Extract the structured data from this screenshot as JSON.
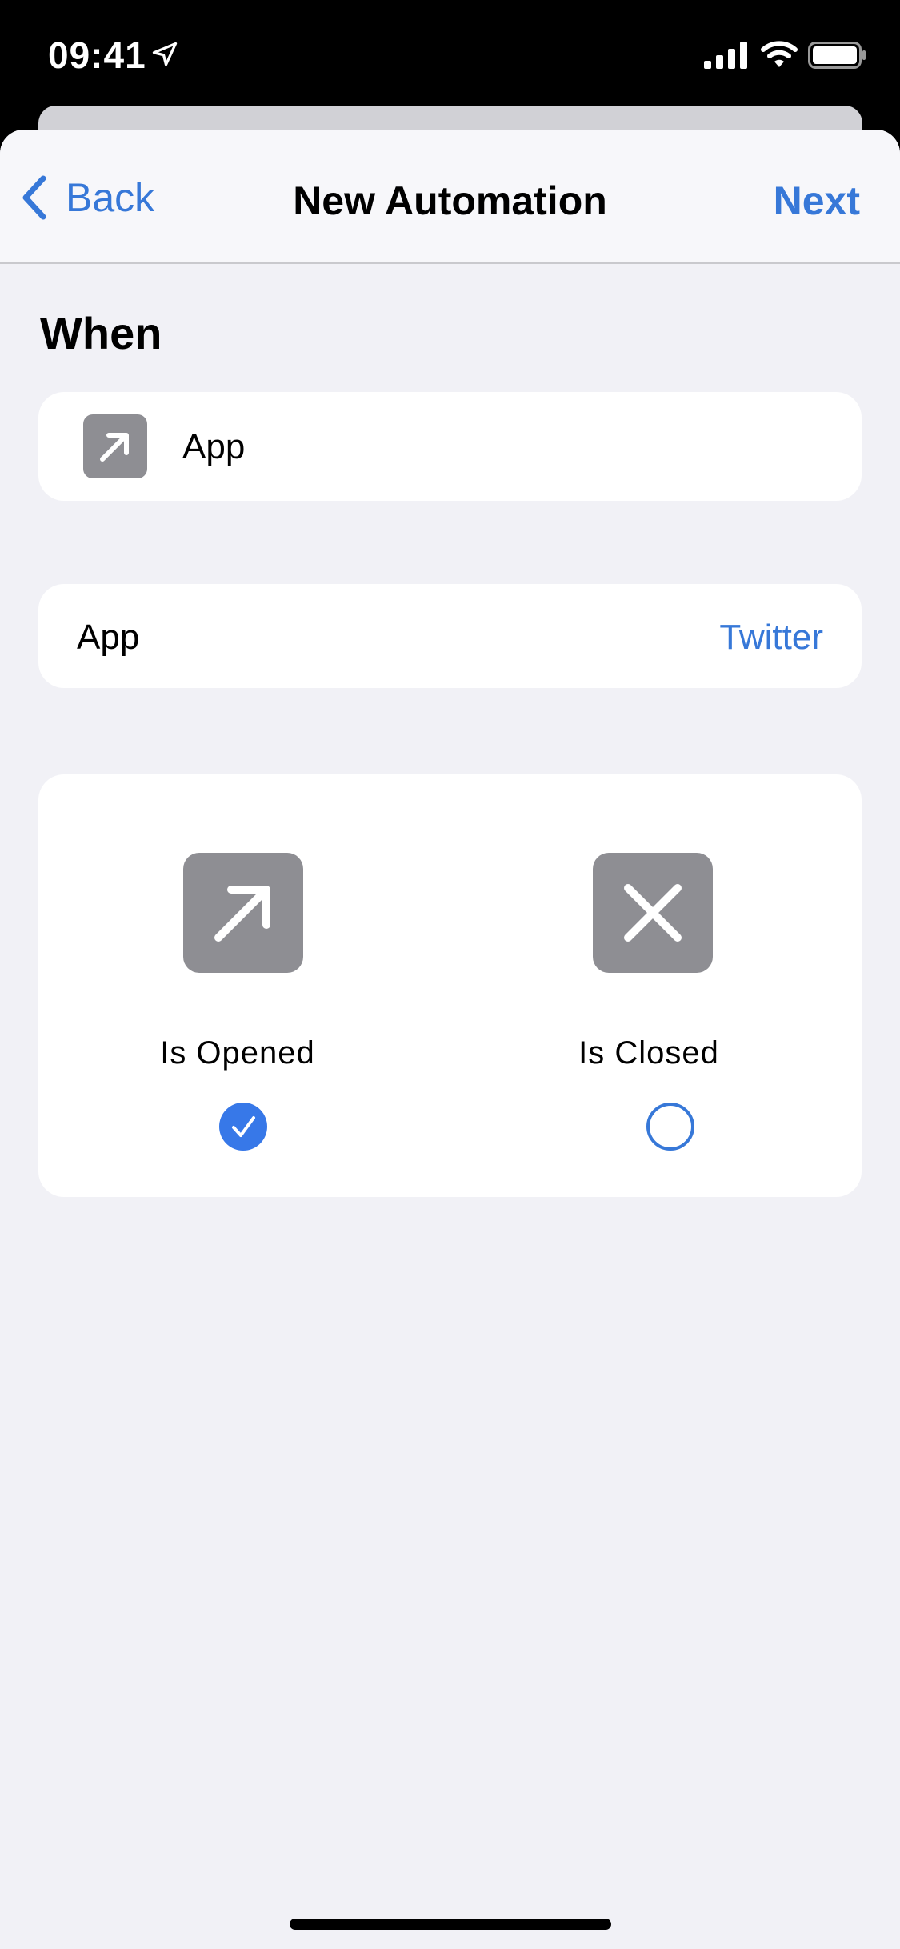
{
  "status_bar": {
    "time": "09:41"
  },
  "nav": {
    "back_label": "Back",
    "title": "New Automation",
    "next_label": "Next"
  },
  "section": {
    "header": "When"
  },
  "trigger": {
    "label": "App",
    "icon": "arrow-up-right-icon"
  },
  "app_row": {
    "label": "App",
    "value": "Twitter"
  },
  "options": {
    "opened": {
      "label": "Is Opened",
      "selected": true,
      "icon": "arrow-up-right-icon"
    },
    "closed": {
      "label": "Is Closed",
      "selected": false,
      "icon": "x-mark-icon"
    }
  },
  "colors": {
    "accent": "#3778d8",
    "icon_gray": "#8e8e93",
    "background": "#f1f1f6"
  }
}
